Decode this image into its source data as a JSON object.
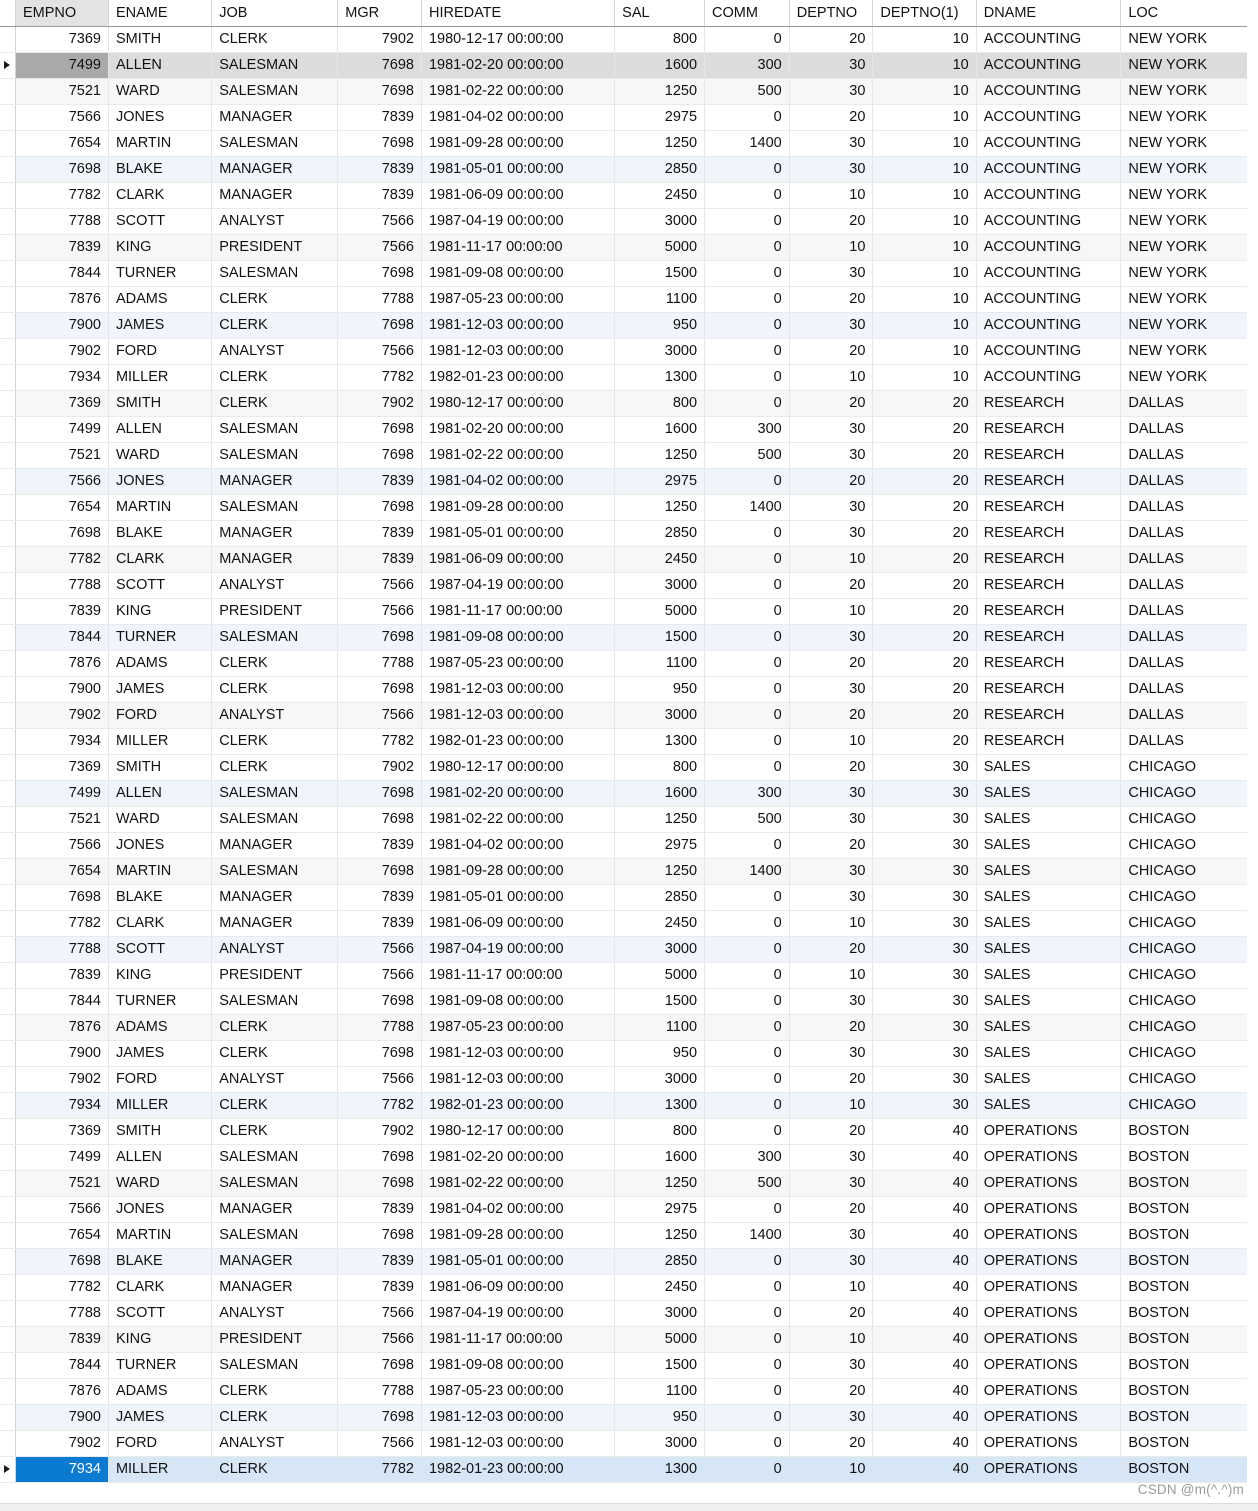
{
  "grid": {
    "name": "query-result-grid",
    "columns": [
      {
        "key": "empno",
        "label": "EMPNO",
        "align": "num",
        "sorted": true
      },
      {
        "key": "ename",
        "label": "ENAME",
        "align": "txt",
        "sorted": false
      },
      {
        "key": "job",
        "label": "JOB",
        "align": "txt",
        "sorted": false
      },
      {
        "key": "mgr",
        "label": "MGR",
        "align": "num",
        "sorted": false
      },
      {
        "key": "hiredate",
        "label": "HIREDATE",
        "align": "txt",
        "sorted": false
      },
      {
        "key": "sal",
        "label": "SAL",
        "align": "num",
        "sorted": false
      },
      {
        "key": "comm",
        "label": "COMM",
        "align": "num",
        "sorted": false
      },
      {
        "key": "deptno",
        "label": "DEPTNO",
        "align": "num",
        "sorted": false
      },
      {
        "key": "deptno1",
        "label": "DEPTNO(1)",
        "align": "num",
        "sorted": false
      },
      {
        "key": "dname",
        "label": "DNAME",
        "align": "txt",
        "sorted": false
      },
      {
        "key": "loc",
        "label": "LOC",
        "align": "txt",
        "sorted": false
      }
    ],
    "current_row_index": 1,
    "selected_row_index": 55,
    "row_indicator_icon": "triangle-right-icon",
    "rows": [
      [
        "7369",
        "SMITH",
        "CLERK",
        "7902",
        "1980-12-17 00:00:00",
        "800",
        "0",
        "20",
        "10",
        "ACCOUNTING",
        "NEW YORK"
      ],
      [
        "7499",
        "ALLEN",
        "SALESMAN",
        "7698",
        "1981-02-20 00:00:00",
        "1600",
        "300",
        "30",
        "10",
        "ACCOUNTING",
        "NEW YORK"
      ],
      [
        "7521",
        "WARD",
        "SALESMAN",
        "7698",
        "1981-02-22 00:00:00",
        "1250",
        "500",
        "30",
        "10",
        "ACCOUNTING",
        "NEW YORK"
      ],
      [
        "7566",
        "JONES",
        "MANAGER",
        "7839",
        "1981-04-02 00:00:00",
        "2975",
        "0",
        "20",
        "10",
        "ACCOUNTING",
        "NEW YORK"
      ],
      [
        "7654",
        "MARTIN",
        "SALESMAN",
        "7698",
        "1981-09-28 00:00:00",
        "1250",
        "1400",
        "30",
        "10",
        "ACCOUNTING",
        "NEW YORK"
      ],
      [
        "7698",
        "BLAKE",
        "MANAGER",
        "7839",
        "1981-05-01 00:00:00",
        "2850",
        "0",
        "30",
        "10",
        "ACCOUNTING",
        "NEW YORK"
      ],
      [
        "7782",
        "CLARK",
        "MANAGER",
        "7839",
        "1981-06-09 00:00:00",
        "2450",
        "0",
        "10",
        "10",
        "ACCOUNTING",
        "NEW YORK"
      ],
      [
        "7788",
        "SCOTT",
        "ANALYST",
        "7566",
        "1987-04-19 00:00:00",
        "3000",
        "0",
        "20",
        "10",
        "ACCOUNTING",
        "NEW YORK"
      ],
      [
        "7839",
        "KING",
        "PRESIDENT",
        "7566",
        "1981-11-17 00:00:00",
        "5000",
        "0",
        "10",
        "10",
        "ACCOUNTING",
        "NEW YORK"
      ],
      [
        "7844",
        "TURNER",
        "SALESMAN",
        "7698",
        "1981-09-08 00:00:00",
        "1500",
        "0",
        "30",
        "10",
        "ACCOUNTING",
        "NEW YORK"
      ],
      [
        "7876",
        "ADAMS",
        "CLERK",
        "7788",
        "1987-05-23 00:00:00",
        "1100",
        "0",
        "20",
        "10",
        "ACCOUNTING",
        "NEW YORK"
      ],
      [
        "7900",
        "JAMES",
        "CLERK",
        "7698",
        "1981-12-03 00:00:00",
        "950",
        "0",
        "30",
        "10",
        "ACCOUNTING",
        "NEW YORK"
      ],
      [
        "7902",
        "FORD",
        "ANALYST",
        "7566",
        "1981-12-03 00:00:00",
        "3000",
        "0",
        "20",
        "10",
        "ACCOUNTING",
        "NEW YORK"
      ],
      [
        "7934",
        "MILLER",
        "CLERK",
        "7782",
        "1982-01-23 00:00:00",
        "1300",
        "0",
        "10",
        "10",
        "ACCOUNTING",
        "NEW YORK"
      ],
      [
        "7369",
        "SMITH",
        "CLERK",
        "7902",
        "1980-12-17 00:00:00",
        "800",
        "0",
        "20",
        "20",
        "RESEARCH",
        "DALLAS"
      ],
      [
        "7499",
        "ALLEN",
        "SALESMAN",
        "7698",
        "1981-02-20 00:00:00",
        "1600",
        "300",
        "30",
        "20",
        "RESEARCH",
        "DALLAS"
      ],
      [
        "7521",
        "WARD",
        "SALESMAN",
        "7698",
        "1981-02-22 00:00:00",
        "1250",
        "500",
        "30",
        "20",
        "RESEARCH",
        "DALLAS"
      ],
      [
        "7566",
        "JONES",
        "MANAGER",
        "7839",
        "1981-04-02 00:00:00",
        "2975",
        "0",
        "20",
        "20",
        "RESEARCH",
        "DALLAS"
      ],
      [
        "7654",
        "MARTIN",
        "SALESMAN",
        "7698",
        "1981-09-28 00:00:00",
        "1250",
        "1400",
        "30",
        "20",
        "RESEARCH",
        "DALLAS"
      ],
      [
        "7698",
        "BLAKE",
        "MANAGER",
        "7839",
        "1981-05-01 00:00:00",
        "2850",
        "0",
        "30",
        "20",
        "RESEARCH",
        "DALLAS"
      ],
      [
        "7782",
        "CLARK",
        "MANAGER",
        "7839",
        "1981-06-09 00:00:00",
        "2450",
        "0",
        "10",
        "20",
        "RESEARCH",
        "DALLAS"
      ],
      [
        "7788",
        "SCOTT",
        "ANALYST",
        "7566",
        "1987-04-19 00:00:00",
        "3000",
        "0",
        "20",
        "20",
        "RESEARCH",
        "DALLAS"
      ],
      [
        "7839",
        "KING",
        "PRESIDENT",
        "7566",
        "1981-11-17 00:00:00",
        "5000",
        "0",
        "10",
        "20",
        "RESEARCH",
        "DALLAS"
      ],
      [
        "7844",
        "TURNER",
        "SALESMAN",
        "7698",
        "1981-09-08 00:00:00",
        "1500",
        "0",
        "30",
        "20",
        "RESEARCH",
        "DALLAS"
      ],
      [
        "7876",
        "ADAMS",
        "CLERK",
        "7788",
        "1987-05-23 00:00:00",
        "1100",
        "0",
        "20",
        "20",
        "RESEARCH",
        "DALLAS"
      ],
      [
        "7900",
        "JAMES",
        "CLERK",
        "7698",
        "1981-12-03 00:00:00",
        "950",
        "0",
        "30",
        "20",
        "RESEARCH",
        "DALLAS"
      ],
      [
        "7902",
        "FORD",
        "ANALYST",
        "7566",
        "1981-12-03 00:00:00",
        "3000",
        "0",
        "20",
        "20",
        "RESEARCH",
        "DALLAS"
      ],
      [
        "7934",
        "MILLER",
        "CLERK",
        "7782",
        "1982-01-23 00:00:00",
        "1300",
        "0",
        "10",
        "20",
        "RESEARCH",
        "DALLAS"
      ],
      [
        "7369",
        "SMITH",
        "CLERK",
        "7902",
        "1980-12-17 00:00:00",
        "800",
        "0",
        "20",
        "30",
        "SALES",
        "CHICAGO"
      ],
      [
        "7499",
        "ALLEN",
        "SALESMAN",
        "7698",
        "1981-02-20 00:00:00",
        "1600",
        "300",
        "30",
        "30",
        "SALES",
        "CHICAGO"
      ],
      [
        "7521",
        "WARD",
        "SALESMAN",
        "7698",
        "1981-02-22 00:00:00",
        "1250",
        "500",
        "30",
        "30",
        "SALES",
        "CHICAGO"
      ],
      [
        "7566",
        "JONES",
        "MANAGER",
        "7839",
        "1981-04-02 00:00:00",
        "2975",
        "0",
        "20",
        "30",
        "SALES",
        "CHICAGO"
      ],
      [
        "7654",
        "MARTIN",
        "SALESMAN",
        "7698",
        "1981-09-28 00:00:00",
        "1250",
        "1400",
        "30",
        "30",
        "SALES",
        "CHICAGO"
      ],
      [
        "7698",
        "BLAKE",
        "MANAGER",
        "7839",
        "1981-05-01 00:00:00",
        "2850",
        "0",
        "30",
        "30",
        "SALES",
        "CHICAGO"
      ],
      [
        "7782",
        "CLARK",
        "MANAGER",
        "7839",
        "1981-06-09 00:00:00",
        "2450",
        "0",
        "10",
        "30",
        "SALES",
        "CHICAGO"
      ],
      [
        "7788",
        "SCOTT",
        "ANALYST",
        "7566",
        "1987-04-19 00:00:00",
        "3000",
        "0",
        "20",
        "30",
        "SALES",
        "CHICAGO"
      ],
      [
        "7839",
        "KING",
        "PRESIDENT",
        "7566",
        "1981-11-17 00:00:00",
        "5000",
        "0",
        "10",
        "30",
        "SALES",
        "CHICAGO"
      ],
      [
        "7844",
        "TURNER",
        "SALESMAN",
        "7698",
        "1981-09-08 00:00:00",
        "1500",
        "0",
        "30",
        "30",
        "SALES",
        "CHICAGO"
      ],
      [
        "7876",
        "ADAMS",
        "CLERK",
        "7788",
        "1987-05-23 00:00:00",
        "1100",
        "0",
        "20",
        "30",
        "SALES",
        "CHICAGO"
      ],
      [
        "7900",
        "JAMES",
        "CLERK",
        "7698",
        "1981-12-03 00:00:00",
        "950",
        "0",
        "30",
        "30",
        "SALES",
        "CHICAGO"
      ],
      [
        "7902",
        "FORD",
        "ANALYST",
        "7566",
        "1981-12-03 00:00:00",
        "3000",
        "0",
        "20",
        "30",
        "SALES",
        "CHICAGO"
      ],
      [
        "7934",
        "MILLER",
        "CLERK",
        "7782",
        "1982-01-23 00:00:00",
        "1300",
        "0",
        "10",
        "30",
        "SALES",
        "CHICAGO"
      ],
      [
        "7369",
        "SMITH",
        "CLERK",
        "7902",
        "1980-12-17 00:00:00",
        "800",
        "0",
        "20",
        "40",
        "OPERATIONS",
        "BOSTON"
      ],
      [
        "7499",
        "ALLEN",
        "SALESMAN",
        "7698",
        "1981-02-20 00:00:00",
        "1600",
        "300",
        "30",
        "40",
        "OPERATIONS",
        "BOSTON"
      ],
      [
        "7521",
        "WARD",
        "SALESMAN",
        "7698",
        "1981-02-22 00:00:00",
        "1250",
        "500",
        "30",
        "40",
        "OPERATIONS",
        "BOSTON"
      ],
      [
        "7566",
        "JONES",
        "MANAGER",
        "7839",
        "1981-04-02 00:00:00",
        "2975",
        "0",
        "20",
        "40",
        "OPERATIONS",
        "BOSTON"
      ],
      [
        "7654",
        "MARTIN",
        "SALESMAN",
        "7698",
        "1981-09-28 00:00:00",
        "1250",
        "1400",
        "30",
        "40",
        "OPERATIONS",
        "BOSTON"
      ],
      [
        "7698",
        "BLAKE",
        "MANAGER",
        "7839",
        "1981-05-01 00:00:00",
        "2850",
        "0",
        "30",
        "40",
        "OPERATIONS",
        "BOSTON"
      ],
      [
        "7782",
        "CLARK",
        "MANAGER",
        "7839",
        "1981-06-09 00:00:00",
        "2450",
        "0",
        "10",
        "40",
        "OPERATIONS",
        "BOSTON"
      ],
      [
        "7788",
        "SCOTT",
        "ANALYST",
        "7566",
        "1987-04-19 00:00:00",
        "3000",
        "0",
        "20",
        "40",
        "OPERATIONS",
        "BOSTON"
      ],
      [
        "7839",
        "KING",
        "PRESIDENT",
        "7566",
        "1981-11-17 00:00:00",
        "5000",
        "0",
        "10",
        "40",
        "OPERATIONS",
        "BOSTON"
      ],
      [
        "7844",
        "TURNER",
        "SALESMAN",
        "7698",
        "1981-09-08 00:00:00",
        "1500",
        "0",
        "30",
        "40",
        "OPERATIONS",
        "BOSTON"
      ],
      [
        "7876",
        "ADAMS",
        "CLERK",
        "7788",
        "1987-05-23 00:00:00",
        "1100",
        "0",
        "20",
        "40",
        "OPERATIONS",
        "BOSTON"
      ],
      [
        "7900",
        "JAMES",
        "CLERK",
        "7698",
        "1981-12-03 00:00:00",
        "950",
        "0",
        "30",
        "40",
        "OPERATIONS",
        "BOSTON"
      ],
      [
        "7902",
        "FORD",
        "ANALYST",
        "7566",
        "1981-12-03 00:00:00",
        "3000",
        "0",
        "20",
        "40",
        "OPERATIONS",
        "BOSTON"
      ],
      [
        "7934",
        "MILLER",
        "CLERK",
        "7782",
        "1982-01-23 00:00:00",
        "1300",
        "0",
        "10",
        "40",
        "OPERATIONS",
        "BOSTON"
      ]
    ]
  },
  "watermark": {
    "text": "CSDN @m(^.^)m"
  },
  "colors": {
    "header_sorted_bg": "#e3e3e3",
    "row_stripe_gray": "#f7f7f7",
    "row_stripe_blue": "#f0f5fb",
    "current_row_bg": "#dcdcdc",
    "current_row_first_cell_bg": "#a9a9a9",
    "selected_row_bg": "#d6e6f7",
    "selected_row_first_cell_bg": "#0b7ad1",
    "grid_line": "#e3e6ea"
  }
}
